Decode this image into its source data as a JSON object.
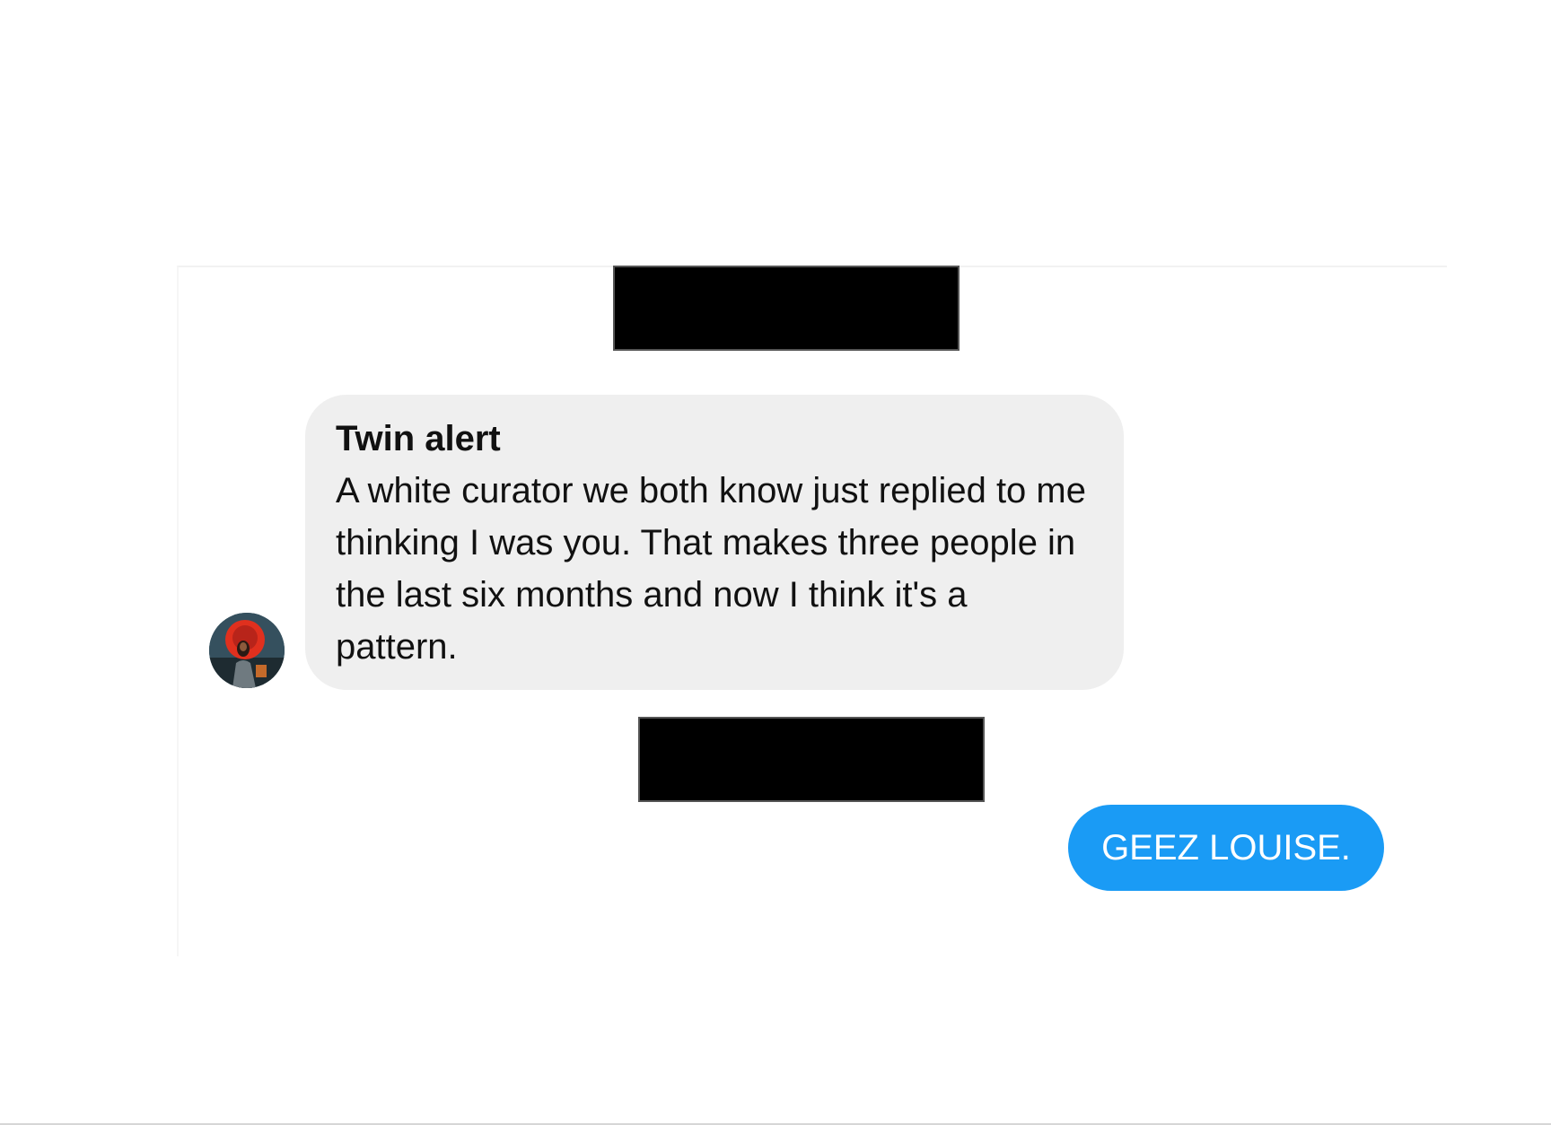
{
  "conversation": {
    "messages": [
      {
        "direction": "incoming",
        "title": "Twin alert",
        "text": "A white curator we both know just replied to me thinking I was you. That makes three people in the last six months and now I think it's a pattern."
      },
      {
        "direction": "outgoing",
        "text": "GEEZ LOUISE."
      }
    ]
  },
  "colors": {
    "incoming_bubble": "#efefef",
    "outgoing_bubble": "#1a9bf5",
    "redaction": "#000000"
  }
}
